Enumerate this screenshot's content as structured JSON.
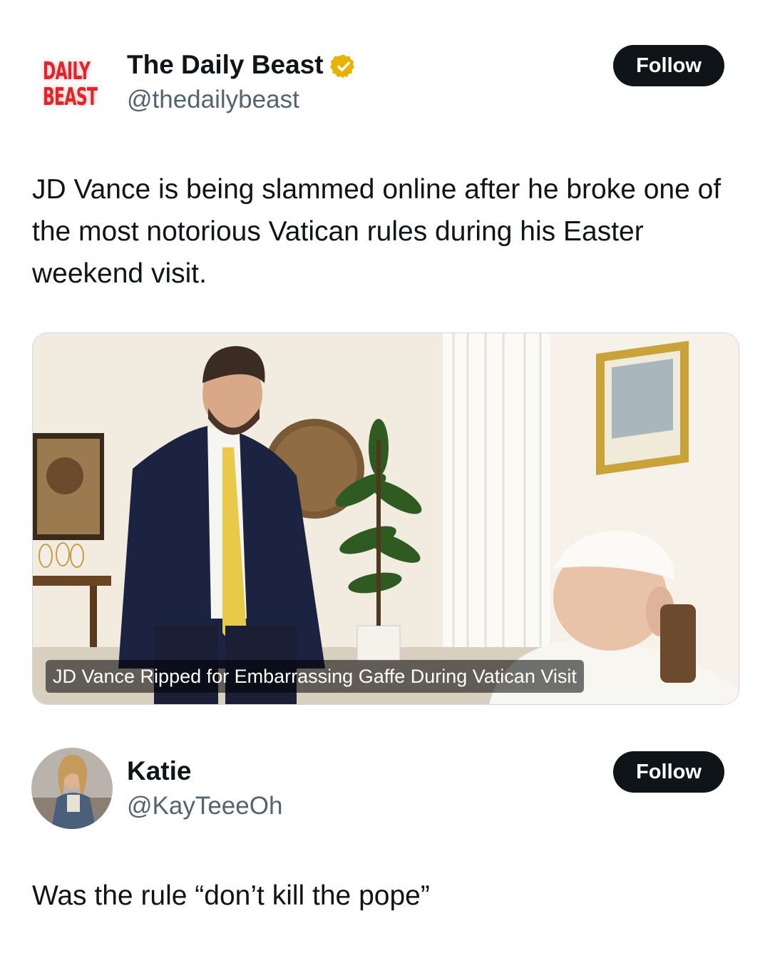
{
  "post": {
    "logo_line1": "DAILY",
    "logo_line2": "BEAST",
    "author_name": "The Daily Beast",
    "author_handle": "@thedailybeast",
    "verified": true,
    "follow_label": "Follow",
    "text": "JD Vance is being slammed online after he broke one of the most notorious Vatican rules during his Easter weekend visit.",
    "media": {
      "caption": "JD Vance Ripped for Embarrassing Gaffe During Vatican Visit"
    }
  },
  "reply": {
    "author_name": "Katie",
    "author_handle": "@KayTeeeOh",
    "follow_label": "Follow",
    "text": "Was the rule “don’t kill the pope”"
  },
  "colors": {
    "text": "#0f1419",
    "secondary": "#536471",
    "button": "#0f1419",
    "verified": "#e8b200",
    "logo": "#e0242a"
  },
  "icons": {
    "verified": "verified-badge-icon"
  }
}
